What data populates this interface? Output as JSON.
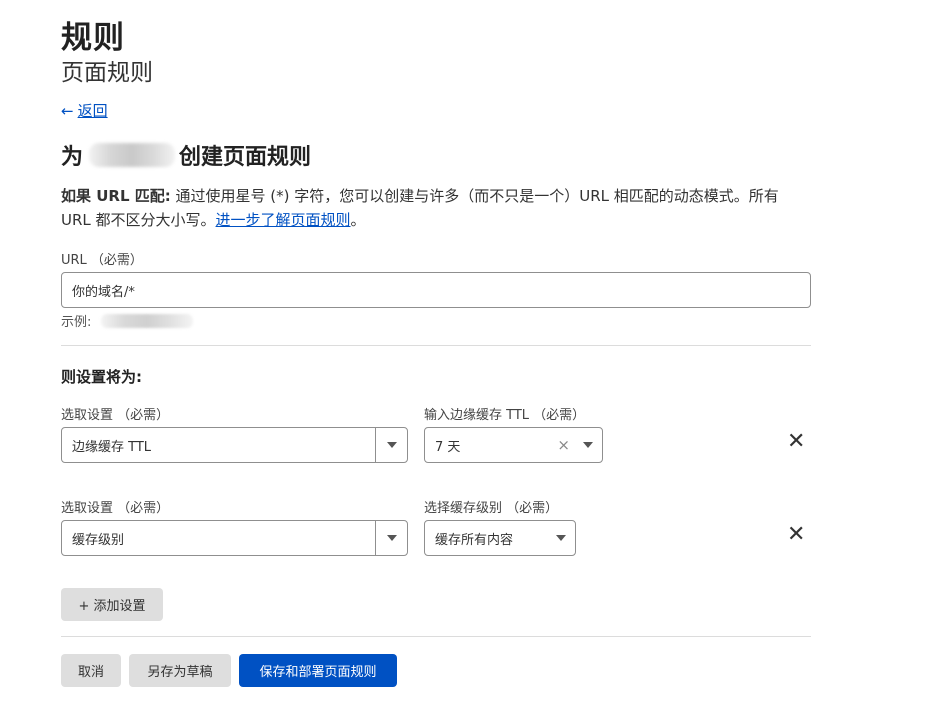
{
  "header": {
    "title": "规则",
    "subtitle": "页面规则"
  },
  "back": {
    "arrow": "←",
    "label": "返回"
  },
  "form": {
    "heading_prefix": "为",
    "heading_suffix": "创建页面规则",
    "intro_bold": "如果 URL 匹配:",
    "intro_text": " 通过使用星号 (*) 字符，您可以创建与许多（而不只是一个）URL 相匹配的动态模式。所有 URL 都不区分大小写。",
    "intro_link": "进一步了解页面规则",
    "intro_end": "。",
    "url_label": "URL （必需）",
    "url_value": "你的域名/*",
    "example_label": "示例:"
  },
  "settings": {
    "title": "则设置将为:",
    "rows": [
      {
        "pick_label": "选取设置 （必需）",
        "pick_value": "边缘缓存 TTL",
        "value_label": "输入边缘缓存 TTL （必需）",
        "value": "7 天",
        "clear_icon": "×",
        "remove_icon": "✕"
      },
      {
        "pick_label": "选取设置 （必需）",
        "pick_value": "缓存级别",
        "value_label": "选择缓存级别 （必需）",
        "value": "缓存所有内容",
        "remove_icon": "✕"
      }
    ],
    "add_button": "+ 添加设置"
  },
  "actions": {
    "cancel": "取消",
    "save_draft": "另存为草稿",
    "save_deploy": "保存和部署页面规则"
  },
  "colors": {
    "accent": "#0051c3",
    "button_grey": "#dedede"
  }
}
